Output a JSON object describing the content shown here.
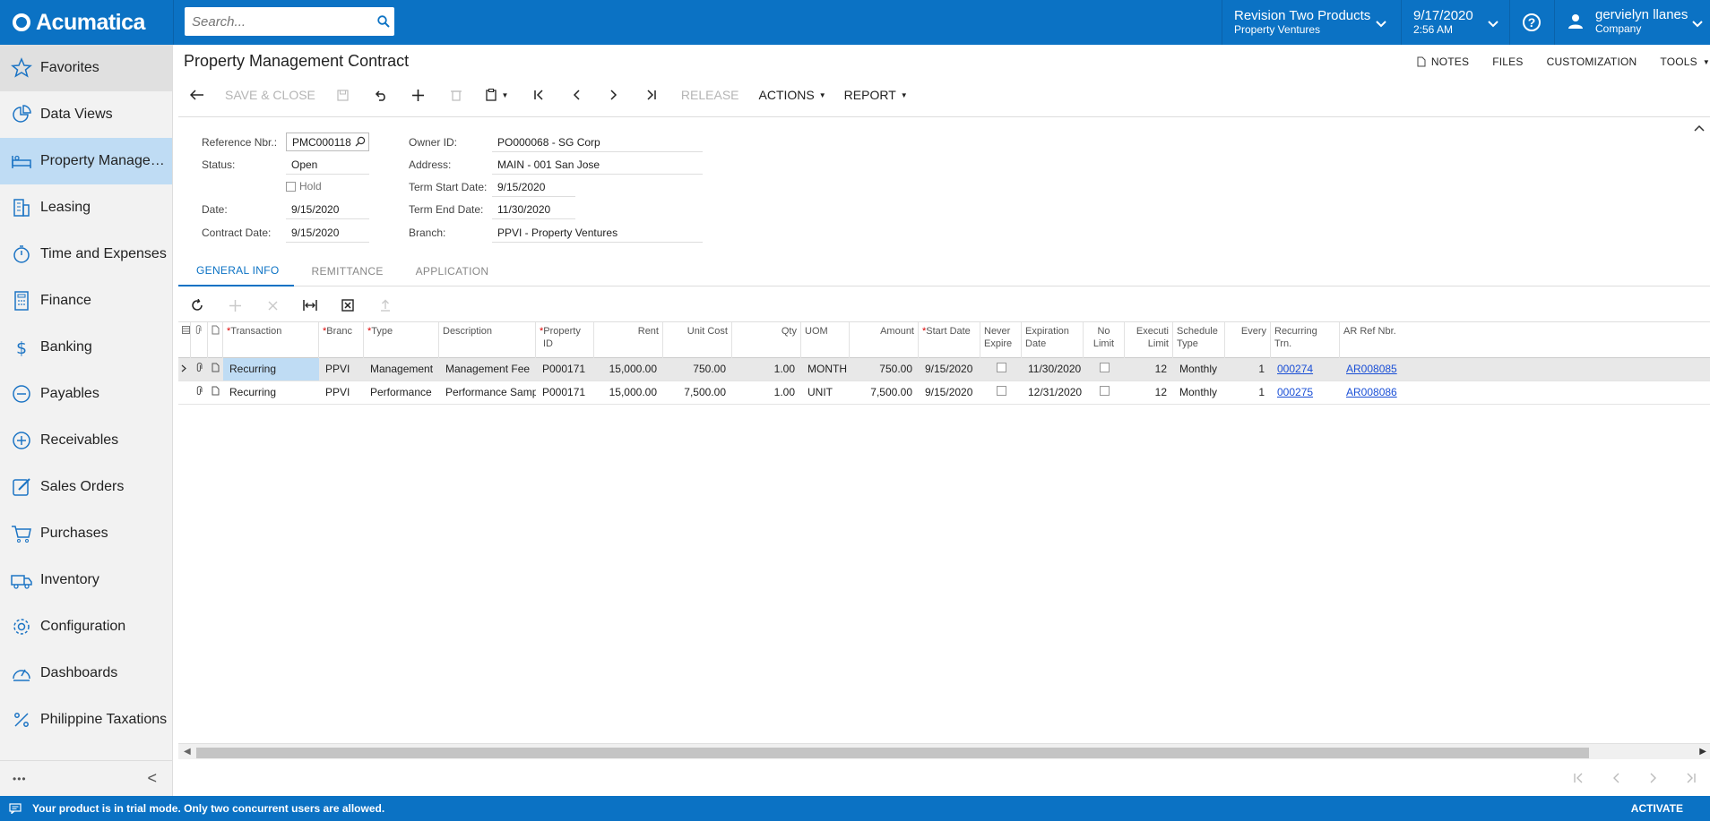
{
  "app": {
    "brand": "Acumatica",
    "search_placeholder": "Search...",
    "company": {
      "name": "Revision Two Products",
      "branch": "Property Ventures"
    },
    "datetime": {
      "date": "9/17/2020",
      "time": "2:56 AM"
    },
    "user": {
      "name": "gervielyn llanes",
      "role": "Company"
    }
  },
  "sidebar": {
    "items": [
      {
        "label": "Favorites",
        "icon": "star-icon"
      },
      {
        "label": "Data Views",
        "icon": "pie-chart-icon"
      },
      {
        "label": "Property Managem...",
        "icon": "bed-icon"
      },
      {
        "label": "Leasing",
        "icon": "building-icon"
      },
      {
        "label": "Time and Expenses",
        "icon": "stopwatch-icon"
      },
      {
        "label": "Finance",
        "icon": "calculator-icon"
      },
      {
        "label": "Banking",
        "icon": "dollar-icon"
      },
      {
        "label": "Payables",
        "icon": "minus-circle-icon"
      },
      {
        "label": "Receivables",
        "icon": "plus-circle-icon"
      },
      {
        "label": "Sales Orders",
        "icon": "edit-icon"
      },
      {
        "label": "Purchases",
        "icon": "cart-icon"
      },
      {
        "label": "Inventory",
        "icon": "truck-icon"
      },
      {
        "label": "Configuration",
        "icon": "gear-icon"
      },
      {
        "label": "Dashboards",
        "icon": "gauge-icon"
      },
      {
        "label": "Philippine Taxations",
        "icon": "percent-icon"
      }
    ],
    "footer_more": "•••",
    "footer_collapse": "<"
  },
  "page": {
    "title": "Property Management Contract",
    "links": {
      "notes": "NOTES",
      "files": "FILES",
      "customization": "CUSTOMIZATION",
      "tools": "TOOLS"
    }
  },
  "toolbar": {
    "save_close": "SAVE & CLOSE",
    "release": "RELEASE",
    "actions": "ACTIONS",
    "report": "REPORT"
  },
  "form": {
    "reference_nbr": {
      "label": "Reference Nbr.:",
      "value": "PMC000118"
    },
    "status": {
      "label": "Status:",
      "value": "Open"
    },
    "hold": {
      "label": "Hold"
    },
    "date": {
      "label": "Date:",
      "value": "9/15/2020"
    },
    "contract_date": {
      "label": "Contract Date:",
      "value": "9/15/2020"
    },
    "owner_id": {
      "label": "Owner ID:",
      "value": "PO000068 - SG Corp"
    },
    "address": {
      "label": "Address:",
      "value": "MAIN - 001 San Jose"
    },
    "term_start": {
      "label": "Term Start Date:",
      "value": "9/15/2020"
    },
    "term_end": {
      "label": "Term End Date:",
      "value": "11/30/2020"
    },
    "branch": {
      "label": "Branch:",
      "value": "PPVI - Property Ventures"
    }
  },
  "tabs": [
    {
      "label": "GENERAL INFO",
      "active": true
    },
    {
      "label": "REMITTANCE",
      "active": false
    },
    {
      "label": "APPLICATION",
      "active": false
    }
  ],
  "grid": {
    "columns": {
      "transaction": "Transaction",
      "branch": "Branc",
      "type": "Type",
      "description": "Description",
      "property_id_1": "Property",
      "property_id_2": "ID",
      "rent": "Rent",
      "unit_cost": "Unit Cost",
      "qty": "Qty",
      "uom": "UOM",
      "amount": "Amount",
      "start_date": "Start Date",
      "never_expire_1": "Never",
      "never_expire_2": "Expire",
      "expiration_1": "Expiration",
      "expiration_2": "Date",
      "no_limit_1": "No",
      "no_limit_2": "Limit",
      "exec_limit_1": "Executi",
      "exec_limit_2": "Limit",
      "schedule_1": "Schedule",
      "schedule_2": "Type",
      "every": "Every",
      "recurring_1": "Recurring",
      "recurring_2": "Trn.",
      "ar_ref": "AR Ref Nbr."
    },
    "rows": [
      {
        "transaction": "Recurring",
        "branch": "PPVI",
        "type": "Management",
        "description": "Management Fee",
        "property_id": "P000171",
        "rent": "15,000.00",
        "unit_cost": "750.00",
        "qty": "1.00",
        "uom": "MONTH",
        "amount": "750.00",
        "start_date": "9/15/2020",
        "expiration": "11/30/2020",
        "exec_limit": "12",
        "schedule": "Monthly",
        "every": "1",
        "recurring_trn": "000274",
        "ar_ref": "AR008085"
      },
      {
        "transaction": "Recurring",
        "branch": "PPVI",
        "type": "Performance",
        "description": "Performance Sample",
        "property_id": "P000171",
        "rent": "15,000.00",
        "unit_cost": "7,500.00",
        "qty": "1.00",
        "uom": "UNIT",
        "amount": "7,500.00",
        "start_date": "9/15/2020",
        "expiration": "12/31/2020",
        "exec_limit": "12",
        "schedule": "Monthly",
        "every": "1",
        "recurring_trn": "000275",
        "ar_ref": "AR008086"
      }
    ]
  },
  "statusbar": {
    "message": "Your product is in trial mode. Only two concurrent users are allowed.",
    "activate": "ACTIVATE"
  },
  "colors": {
    "brand_blue": "#0b72c4",
    "selected_blue": "#bfdcf4",
    "link_blue": "#1a4fd6",
    "required_red": "#dd0000"
  }
}
